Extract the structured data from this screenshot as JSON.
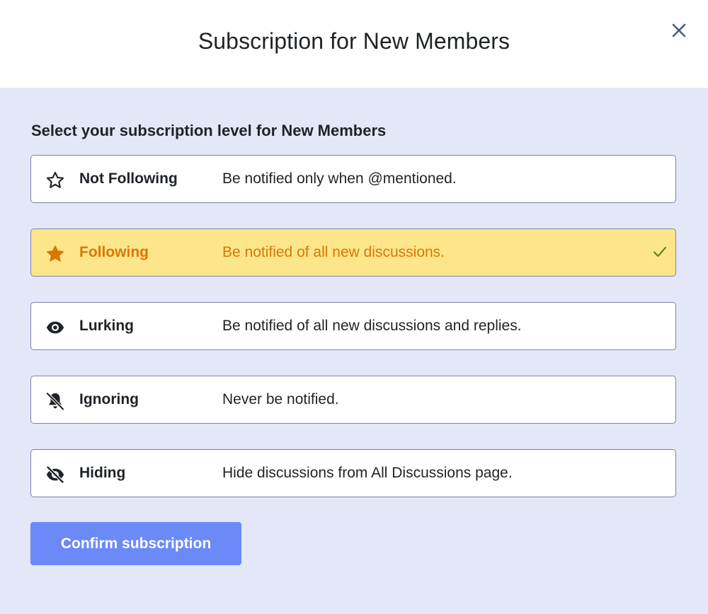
{
  "modal": {
    "title": "Subscription for New Members",
    "close_icon": "close-icon"
  },
  "section": {
    "title": "Select your subscription level for New Members"
  },
  "options": [
    {
      "name": "Not Following",
      "description": "Be notified only when @mentioned.",
      "icon": "star-outline-icon",
      "selected": false
    },
    {
      "name": "Following",
      "description": "Be notified of all new discussions.",
      "icon": "star-filled-icon",
      "selected": true
    },
    {
      "name": "Lurking",
      "description": "Be notified of all new discussions and replies.",
      "icon": "eye-icon",
      "selected": false
    },
    {
      "name": "Ignoring",
      "description": "Never be notified.",
      "icon": "bell-off-icon",
      "selected": false
    },
    {
      "name": "Hiding",
      "description": "Hide discussions from All Discussions page.",
      "icon": "eye-off-icon",
      "selected": false
    }
  ],
  "confirm_button": {
    "label": "Confirm subscription"
  },
  "colors": {
    "accent": "#6b8af7",
    "selected_bg": "#fde68a",
    "selected_text": "#d97706",
    "check": "#4d7c0f",
    "body_bg": "#e3e7f7",
    "close": "#4a5a8a"
  }
}
